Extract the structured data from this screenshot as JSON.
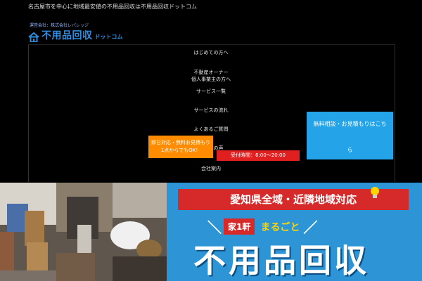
{
  "header": {
    "tagline": "名古屋市を中心に地域最安値の不用品回収は不用品回収ドットコム",
    "company": "運営会社：株式会社レバレッジ",
    "logo_main": "不用品回収",
    "logo_sub": "ドットコム"
  },
  "nav": {
    "items": [
      "はじめての方へ",
      "不動産オーナー",
      "個人事業主の方へ",
      "サービス一覧",
      "サービスの流れ",
      "よくあるご質問",
      "お客様の声",
      "会社案内"
    ]
  },
  "cta": {
    "quote_line1": "無料相談・お見積もりはこち",
    "quote_line2": "ら",
    "same_day_line1": "即日対応・無料お見積もり",
    "same_day_line2": "1点からでもOK！",
    "hours": "受付時間：6:00〜20:00"
  },
  "hero": {
    "area_banner": "愛知県全域・近隣地域対応",
    "tag_prefix": "家1軒",
    "tag_highlight": "まるごと",
    "title": "不用品回収"
  },
  "colors": {
    "background": "#000000",
    "logo_blue": "#2f8de0",
    "quote_blue": "#25a3e8",
    "same_day_orange": "#ff8c00",
    "hours_red": "#e02020",
    "poster_blue": "#2d95d6",
    "banner_red": "#d62a2a",
    "highlight_yellow": "#ffd400"
  },
  "icons": {
    "logo": "house-icon",
    "bulb": "lightbulb-icon"
  }
}
